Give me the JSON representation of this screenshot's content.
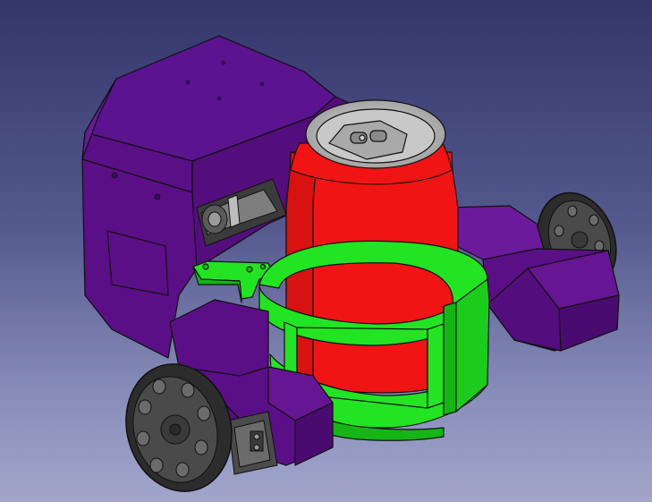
{
  "viewport": {
    "background_top": "#33366a",
    "background_bottom": "#a2a6cc"
  },
  "model": {
    "body_color": "#5a0f86",
    "body_dark": "#4a0b70",
    "body_light": "#6a1a9a",
    "can_color": "#f01414",
    "can_shadow": "#c70f0f",
    "can_top": "#b9b9b9",
    "holder_color": "#22e422",
    "holder_dark": "#15b515",
    "wheel_color": "#4a4a4a",
    "wheel_dark": "#2c2c2c",
    "edge_color": "#101010"
  }
}
